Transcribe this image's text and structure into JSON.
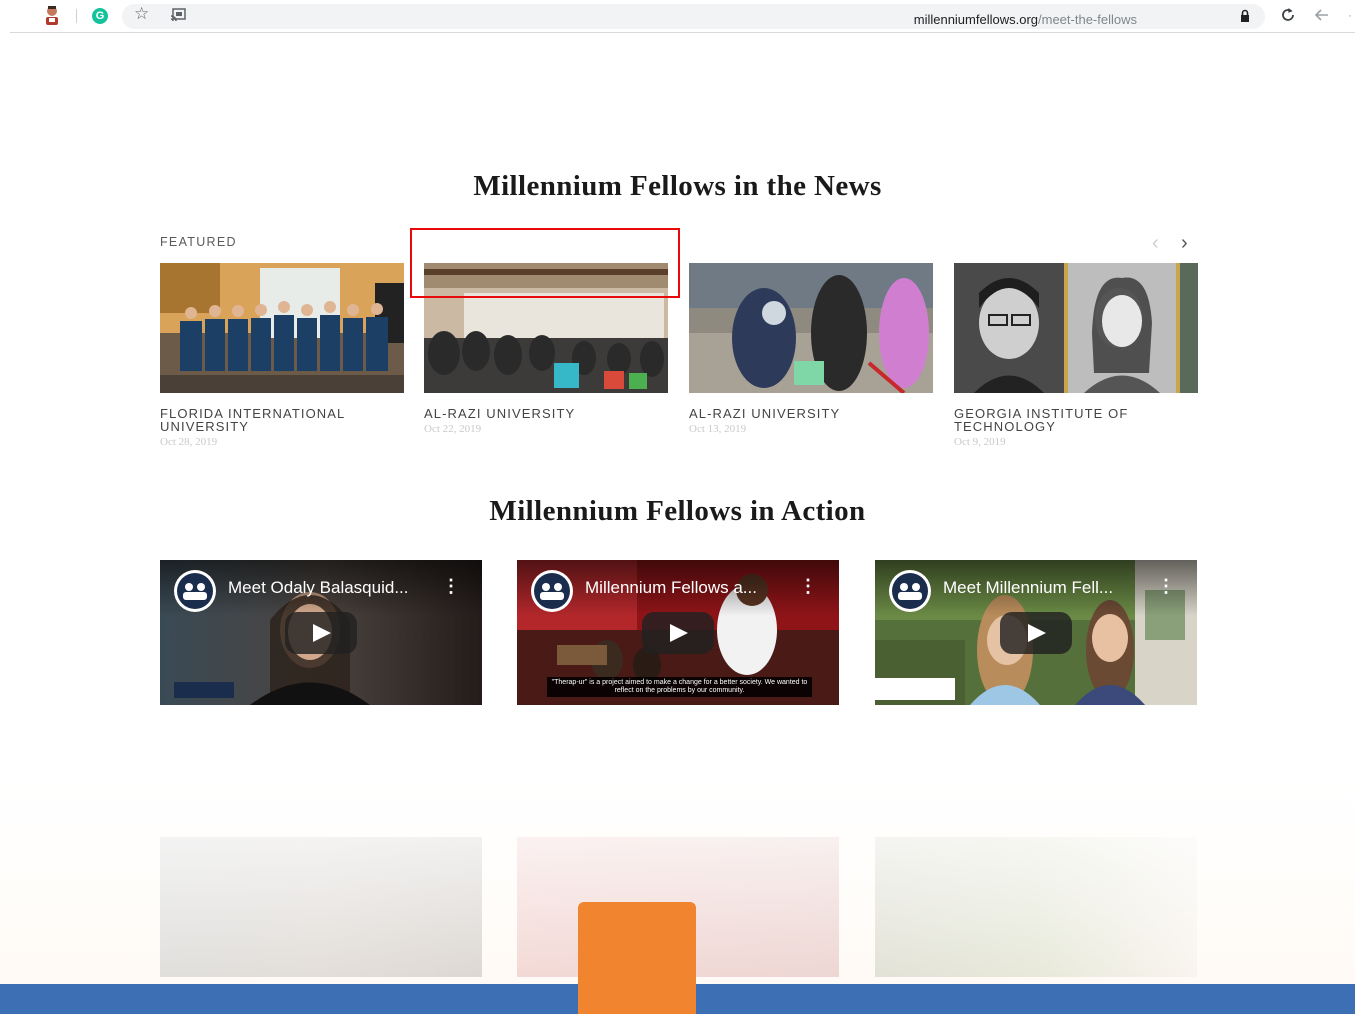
{
  "browser": {
    "url_host": "millenniumfellows.org",
    "url_path": "/meet-the-fellows",
    "extension_letter": "G"
  },
  "news": {
    "title": "Millennium Fellows in the News",
    "featured_label": "FEATURED",
    "cards": [
      {
        "school": "FLORIDA INTERNATIONAL UNIVERSITY",
        "date": "Oct 28, 2019"
      },
      {
        "school": "AL-RAZI UNIVERSITY",
        "date": "Oct 22, 2019"
      },
      {
        "school": "AL-RAZI UNIVERSITY",
        "date": "Oct 13, 2019"
      },
      {
        "school": "GEORGIA INSTITUTE OF TECHNOLOGY",
        "date": "Oct 9, 2019"
      }
    ]
  },
  "action": {
    "title": "Millennium Fellows in Action",
    "videos": [
      {
        "title": "Meet Odaly Balasquid..."
      },
      {
        "title": "Millennium Fellows a...",
        "caption": "\"Therap-ur\" is a project aimed to make a change for a better society. We wanted to reflect on the problems by our community."
      },
      {
        "title": "Meet Millennium Fell..."
      }
    ]
  },
  "colors": {
    "highlight_box": "#e8090a",
    "footer_bar": "#3d6fb5",
    "cta_orange": "#f0842f"
  }
}
